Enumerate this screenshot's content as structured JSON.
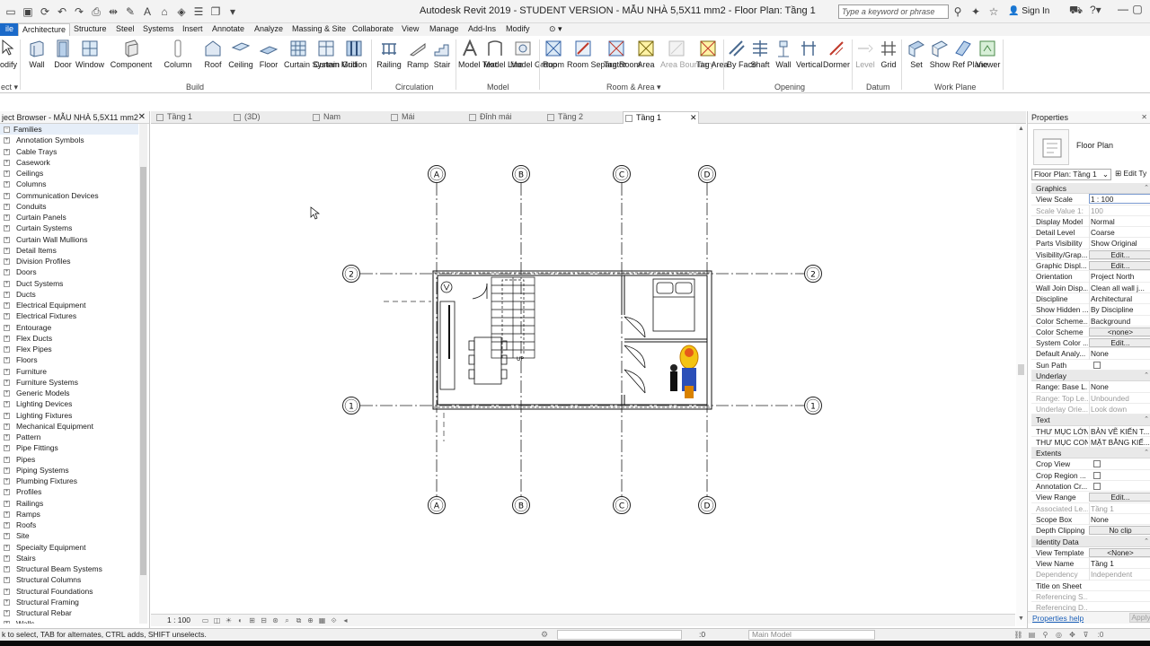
{
  "app": {
    "title": "Autodesk Revit 2019 - STUDENT VERSION - MẪU NHÀ 5,5X11 mm2 - Floor Plan: Tầng 1",
    "search_placeholder": "Type a keyword or phrase",
    "sign_in": "Sign In"
  },
  "ribbon_tabs": [
    {
      "label": "ile",
      "kind": "file"
    },
    {
      "label": "Architecture",
      "kind": "active"
    },
    {
      "label": "Structure"
    },
    {
      "label": "Steel"
    },
    {
      "label": "Systems"
    },
    {
      "label": "Insert"
    },
    {
      "label": "Annotate"
    },
    {
      "label": "Analyze"
    },
    {
      "label": "Massing & Site"
    },
    {
      "label": "Collaborate"
    },
    {
      "label": "View"
    },
    {
      "label": "Manage"
    },
    {
      "label": "Add-Ins"
    },
    {
      "label": "Modify"
    }
  ],
  "ribbon": {
    "modify_label": "odify",
    "select_label": "ect ▾",
    "panels": {
      "build": "Build",
      "circulation": "Circulation",
      "model": "Model",
      "room_area": "Room & Area ▾",
      "opening": "Opening",
      "datum": "Datum",
      "work_plane": "Work Plane"
    },
    "tools": {
      "wall": "Wall",
      "door": "Door",
      "window": "Window",
      "component": "Component",
      "column": "Column",
      "roof": "Roof",
      "ceiling": "Ceiling",
      "floor": "Floor",
      "curtain_system": "Curtain System",
      "curtain_grid": "Curtain Grid",
      "mullion": "Mullion",
      "railing": "Railing",
      "ramp": "Ramp",
      "stair": "Stair",
      "model_text": "Model Text",
      "model_line": "Model Line",
      "model_group": "Model Group",
      "room": "Room",
      "room_separator": "Room Separator",
      "tag_room": "Tag Room",
      "area": "Area",
      "area_boundary": "Area Boundary",
      "tag_area": "Tag Area",
      "by_face": "By Face",
      "shaft": "Shaft",
      "wall_opening": "Wall",
      "vertical": "Vertical",
      "dormer": "Dormer",
      "level": "Level",
      "grid": "Grid",
      "set": "Set",
      "show": "Show",
      "ref_plane": "Ref Plane",
      "viewer": "Viewer"
    }
  },
  "browser": {
    "title": "ject Browser - MẪU NHÀ 5,5X11 mm2",
    "root": "Families",
    "items": [
      "Annotation Symbols",
      "Cable Trays",
      "Casework",
      "Ceilings",
      "Columns",
      "Communication Devices",
      "Conduits",
      "Curtain Panels",
      "Curtain Systems",
      "Curtain Wall Mullions",
      "Detail Items",
      "Division Profiles",
      "Doors",
      "Duct Systems",
      "Ducts",
      "Electrical Equipment",
      "Electrical Fixtures",
      "Entourage",
      "Flex Ducts",
      "Flex Pipes",
      "Floors",
      "Furniture",
      "Furniture Systems",
      "Generic Models",
      "Lighting Devices",
      "Lighting Fixtures",
      "Mechanical Equipment",
      "Pattern",
      "Pipe Fittings",
      "Pipes",
      "Piping Systems",
      "Plumbing Fixtures",
      "Profiles",
      "Railings",
      "Ramps",
      "Roofs",
      "Site",
      "Specialty Equipment",
      "Stairs",
      "Structural Beam Systems",
      "Structural Columns",
      "Structural Foundations",
      "Structural Framing",
      "Structural Rebar",
      "Walls"
    ]
  },
  "doc_tabs": [
    {
      "label": "Tầng 1"
    },
    {
      "label": "(3D)"
    },
    {
      "label": "Nam"
    },
    {
      "label": "Mái"
    },
    {
      "label": "Đỉnh mái"
    },
    {
      "label": "Tầng 2"
    },
    {
      "label": "Tầng 1",
      "active": true
    }
  ],
  "plan": {
    "grid_letters": [
      "A",
      "B",
      "C",
      "D"
    ],
    "grid_numbers": [
      "2",
      "1"
    ],
    "stair_text": "UP"
  },
  "view_bar": {
    "scale": "1 : 100"
  },
  "properties": {
    "title": "Properties",
    "type_name": "Floor Plan",
    "selector": "Floor Plan: Tầng 1",
    "edit_type": "Edit Ty",
    "sections": [
      {
        "name": "Graphics",
        "rows": [
          {
            "k": "View Scale",
            "v": "1 : 100",
            "style": "field"
          },
          {
            "k": "Scale Value   1:",
            "v": "100",
            "dim": true
          },
          {
            "k": "Display Model",
            "v": "Normal"
          },
          {
            "k": "Detail Level",
            "v": "Coarse"
          },
          {
            "k": "Parts Visibility",
            "v": "Show Original"
          },
          {
            "k": "Visibility/Grap...",
            "v": "Edit...",
            "style": "btn"
          },
          {
            "k": "Graphic Displ...",
            "v": "Edit...",
            "style": "btn"
          },
          {
            "k": "Orientation",
            "v": "Project North"
          },
          {
            "k": "Wall Join Disp...",
            "v": "Clean all wall j..."
          },
          {
            "k": "Discipline",
            "v": "Architectural"
          },
          {
            "k": "Show Hidden ...",
            "v": "By Discipline"
          },
          {
            "k": "Color Scheme...",
            "v": "Background"
          },
          {
            "k": "Color Scheme",
            "v": "<none>",
            "style": "btn"
          },
          {
            "k": "System Color ...",
            "v": "Edit...",
            "style": "btn"
          },
          {
            "k": "Default Analy...",
            "v": "None"
          },
          {
            "k": "Sun Path",
            "v": "",
            "style": "cb"
          }
        ]
      },
      {
        "name": "Underlay",
        "rows": [
          {
            "k": "Range: Base L...",
            "v": "None"
          },
          {
            "k": "Range: Top Le...",
            "v": "Unbounded",
            "dim": true
          },
          {
            "k": "Underlay Orie...",
            "v": "Look down",
            "dim": true
          }
        ]
      },
      {
        "name": "Text",
        "rows": [
          {
            "k": "THƯ MỤC LỚN",
            "v": "BẢN VẼ KIẾN T..."
          },
          {
            "k": "THƯ MỤC CON",
            "v": "MẶT BẰNG KIẾ..."
          }
        ]
      },
      {
        "name": "Extents",
        "rows": [
          {
            "k": "Crop View",
            "v": "",
            "style": "cb"
          },
          {
            "k": "Crop Region ...",
            "v": "",
            "style": "cb"
          },
          {
            "k": "Annotation Cr...",
            "v": "",
            "style": "cb"
          },
          {
            "k": "View Range",
            "v": "Edit...",
            "style": "btn"
          },
          {
            "k": "Associated Le...",
            "v": "Tầng 1",
            "dim": true
          },
          {
            "k": "Scope Box",
            "v": "None"
          },
          {
            "k": "Depth Clipping",
            "v": "No clip",
            "style": "btn"
          }
        ]
      },
      {
        "name": "Identity Data",
        "rows": [
          {
            "k": "View Template",
            "v": "<None>",
            "style": "btn"
          },
          {
            "k": "View Name",
            "v": "Tầng 1"
          },
          {
            "k": "Dependency",
            "v": "Independent",
            "dim": true
          },
          {
            "k": "Title on Sheet",
            "v": ""
          },
          {
            "k": "Referencing S...",
            "v": "",
            "dim": true
          },
          {
            "k": "Referencing D...",
            "v": "",
            "dim": true
          }
        ]
      }
    ],
    "help": "Properties help",
    "apply": "Apply"
  },
  "status": {
    "message": "k to select, TAB for alternates, CTRL adds, SHIFT unselects.",
    "zero": ":0",
    "model": "Main Model",
    "filter": ":0"
  },
  "colors": {
    "accent": "#1b6ac9",
    "file_tab": "#1b6ac9",
    "tool_blue": "#2f6fb5"
  }
}
